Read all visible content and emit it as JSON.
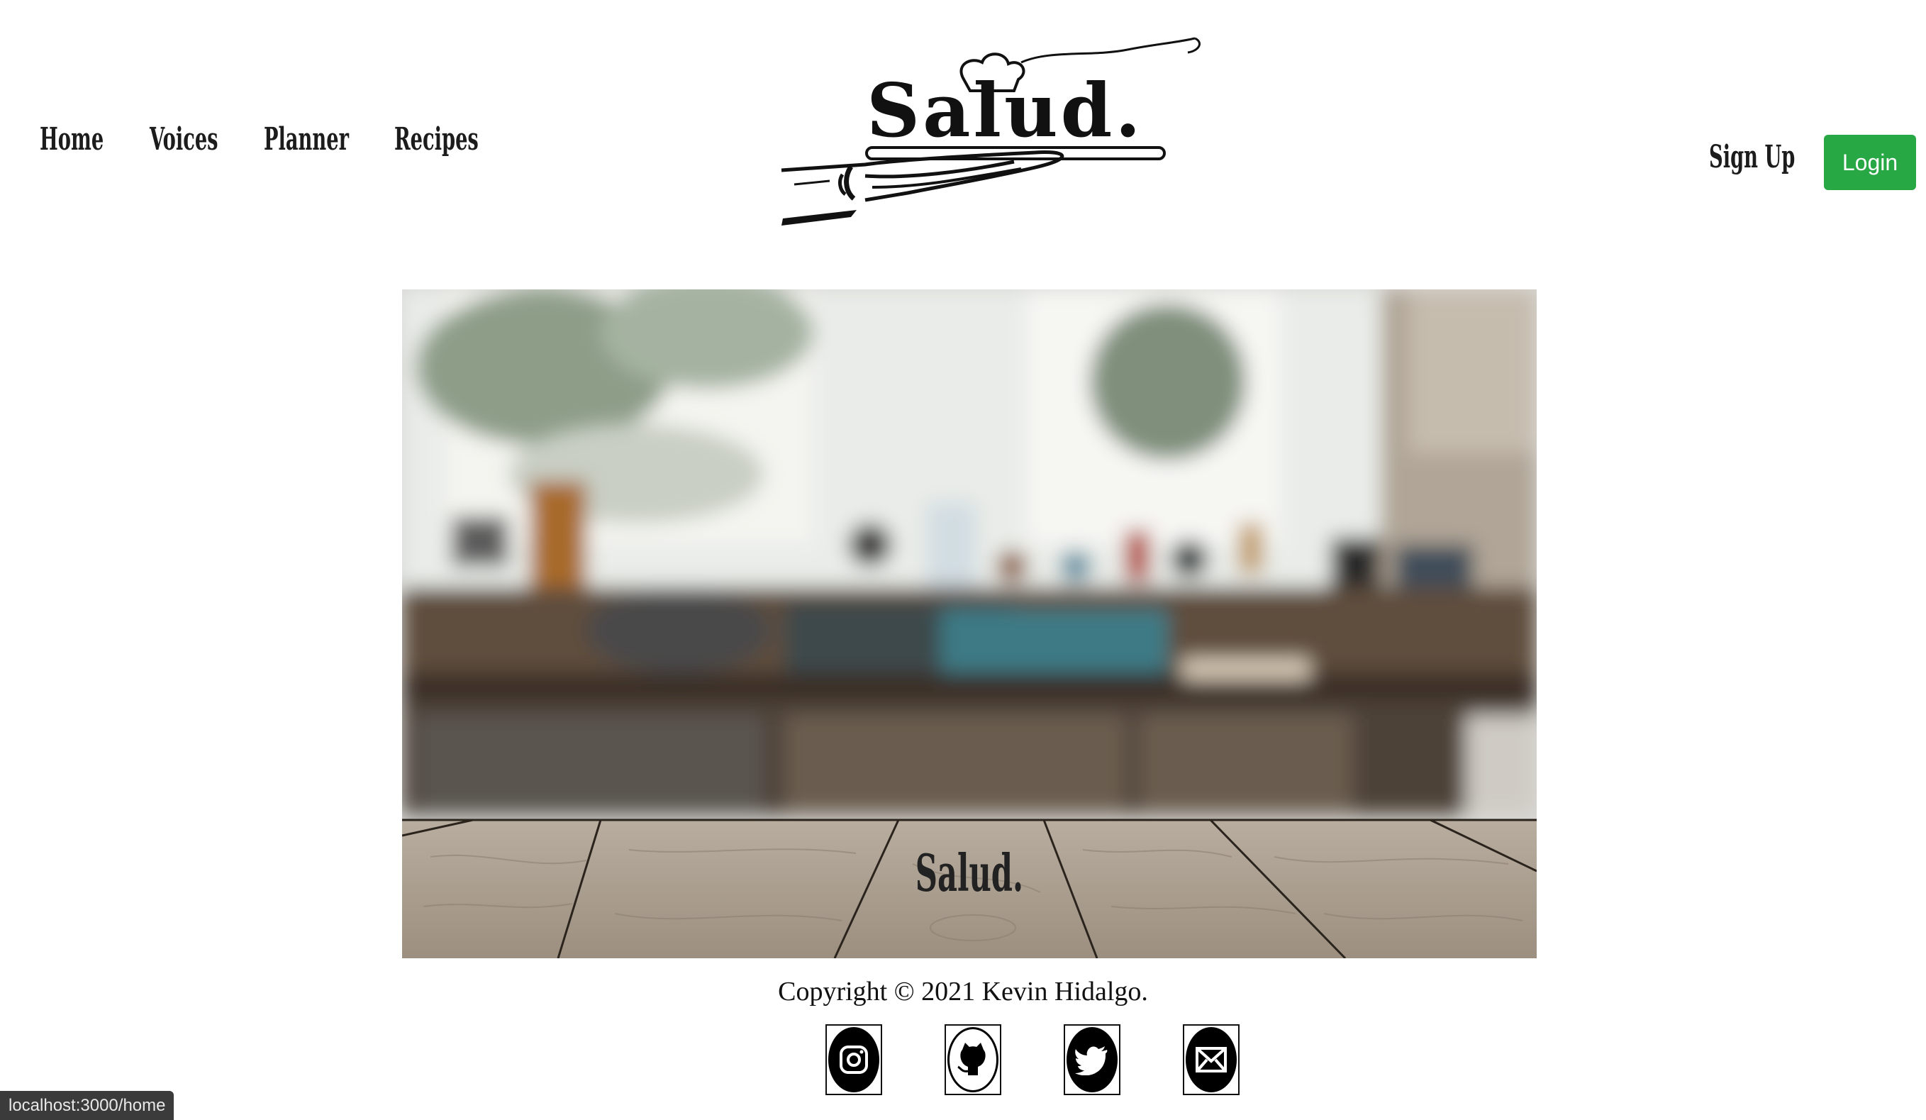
{
  "nav": {
    "home": "Home",
    "voices": "Voices",
    "planner": "Planner",
    "recipes": "Recipes"
  },
  "logo": {
    "text": "Salud."
  },
  "auth": {
    "signup": "Sign Up",
    "login": "Login"
  },
  "hero": {
    "title": "Salud."
  },
  "footer": {
    "copyright": "Copyright © 2021 Kevin Hidalgo.",
    "socials": [
      "instagram-icon",
      "github-icon",
      "twitter-icon",
      "email-icon"
    ]
  },
  "status_bar": {
    "url": "localhost:3000/home"
  },
  "colors": {
    "login_button": "#28a745",
    "text": "#1c1c1c"
  }
}
